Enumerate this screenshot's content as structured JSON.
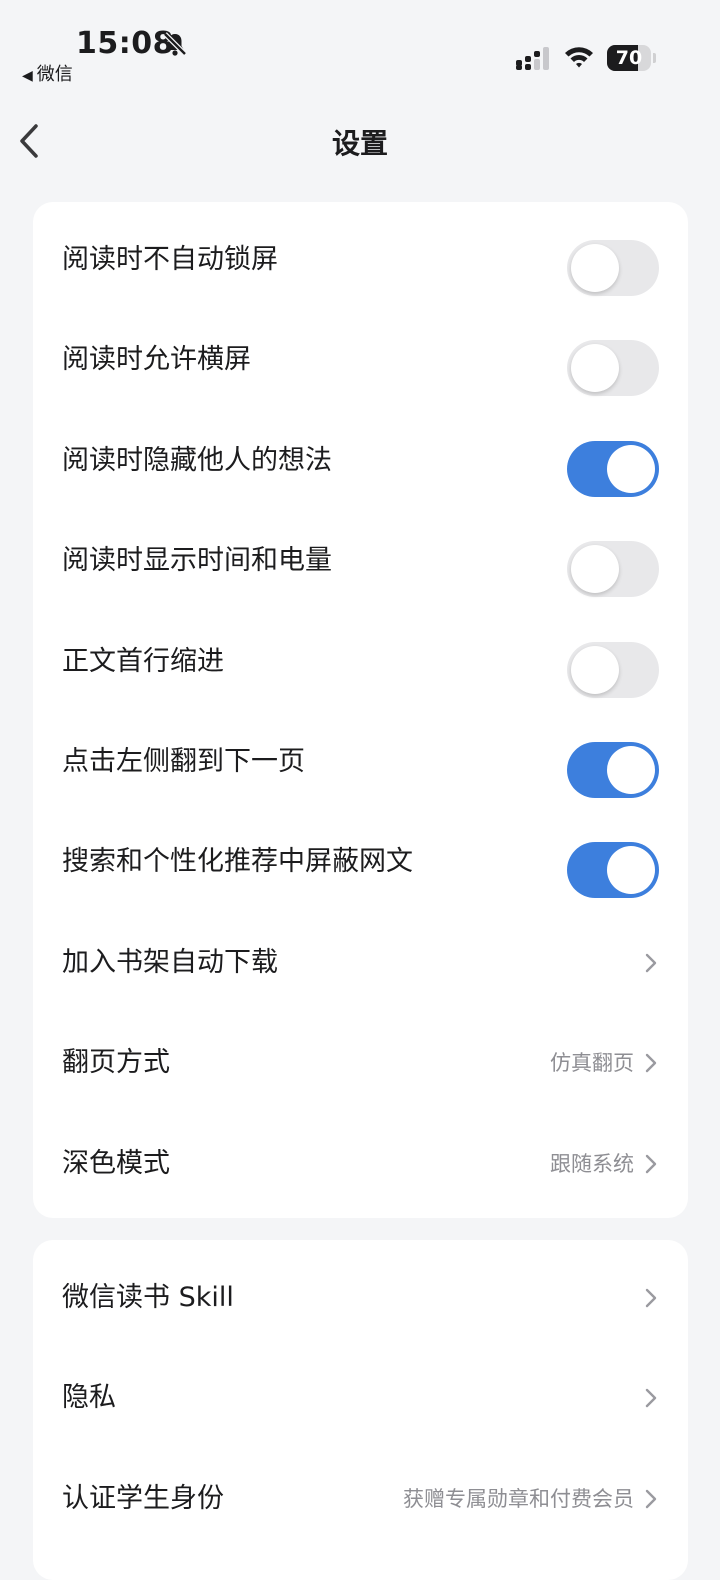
{
  "status_bar": {
    "time": "15:08",
    "back_app": "微信",
    "battery_level": "70",
    "battery_fraction": 0.7,
    "icons": [
      "bell-slash-icon",
      "signal-icon",
      "wifi-icon",
      "battery-icon"
    ]
  },
  "nav": {
    "title": "设置",
    "back_icon": "chevron-left-icon"
  },
  "colors": {
    "accent": "#3d7fdd",
    "toggle_off": "#e8e8ea",
    "background": "#f4f5f7",
    "secondary_text": "#8e8e93"
  },
  "settings_group_1": [
    {
      "label": "阅读时不自动锁屏",
      "type": "toggle",
      "on": false
    },
    {
      "label": "阅读时允许横屏",
      "type": "toggle",
      "on": false
    },
    {
      "label": "阅读时隐藏他人的想法",
      "type": "toggle",
      "on": true
    },
    {
      "label": "阅读时显示时间和电量",
      "type": "toggle",
      "on": false
    },
    {
      "label": "正文首行缩进",
      "type": "toggle",
      "on": false
    },
    {
      "label": "点击左侧翻到下一页",
      "type": "toggle",
      "on": true
    },
    {
      "label": "搜索和个性化推荐中屏蔽网文",
      "type": "toggle",
      "on": true
    },
    {
      "label": "加入书架自动下载",
      "type": "link",
      "value": ""
    },
    {
      "label": "翻页方式",
      "type": "link",
      "value": "仿真翻页"
    },
    {
      "label": "深色模式",
      "type": "link",
      "value": "跟随系统"
    }
  ],
  "settings_group_2": [
    {
      "label": "微信读书 Skill",
      "type": "link",
      "value": ""
    },
    {
      "label": "隐私",
      "type": "link",
      "value": ""
    },
    {
      "label": "认证学生身份",
      "type": "link",
      "value": "获赠专属勋章和付费会员"
    }
  ]
}
